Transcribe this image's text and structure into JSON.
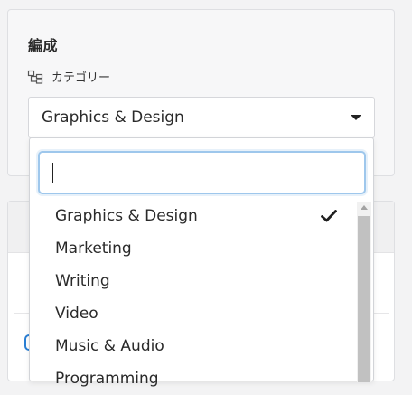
{
  "section": {
    "title": "編成",
    "category_label": "カテゴリー",
    "selected_value": "Graphics & Design"
  },
  "dropdown": {
    "search_value": "",
    "options": [
      {
        "label": "Graphics & Design",
        "selected": true
      },
      {
        "label": "Marketing",
        "selected": false
      },
      {
        "label": "Writing",
        "selected": false
      },
      {
        "label": "Video",
        "selected": false
      },
      {
        "label": "Music & Audio",
        "selected": false
      },
      {
        "label": "Programming",
        "selected": false
      }
    ]
  },
  "icons": {
    "category": "category-tree-icon",
    "dropdown_arrow": "chevron-down-icon",
    "checkmark": "check-icon",
    "scroll_up": "scroll-up-arrow-icon"
  },
  "colors": {
    "focus_border": "#9ec7ec",
    "accent_blue": "#2b7fd3",
    "scroll_thumb": "#c1c1c1"
  }
}
